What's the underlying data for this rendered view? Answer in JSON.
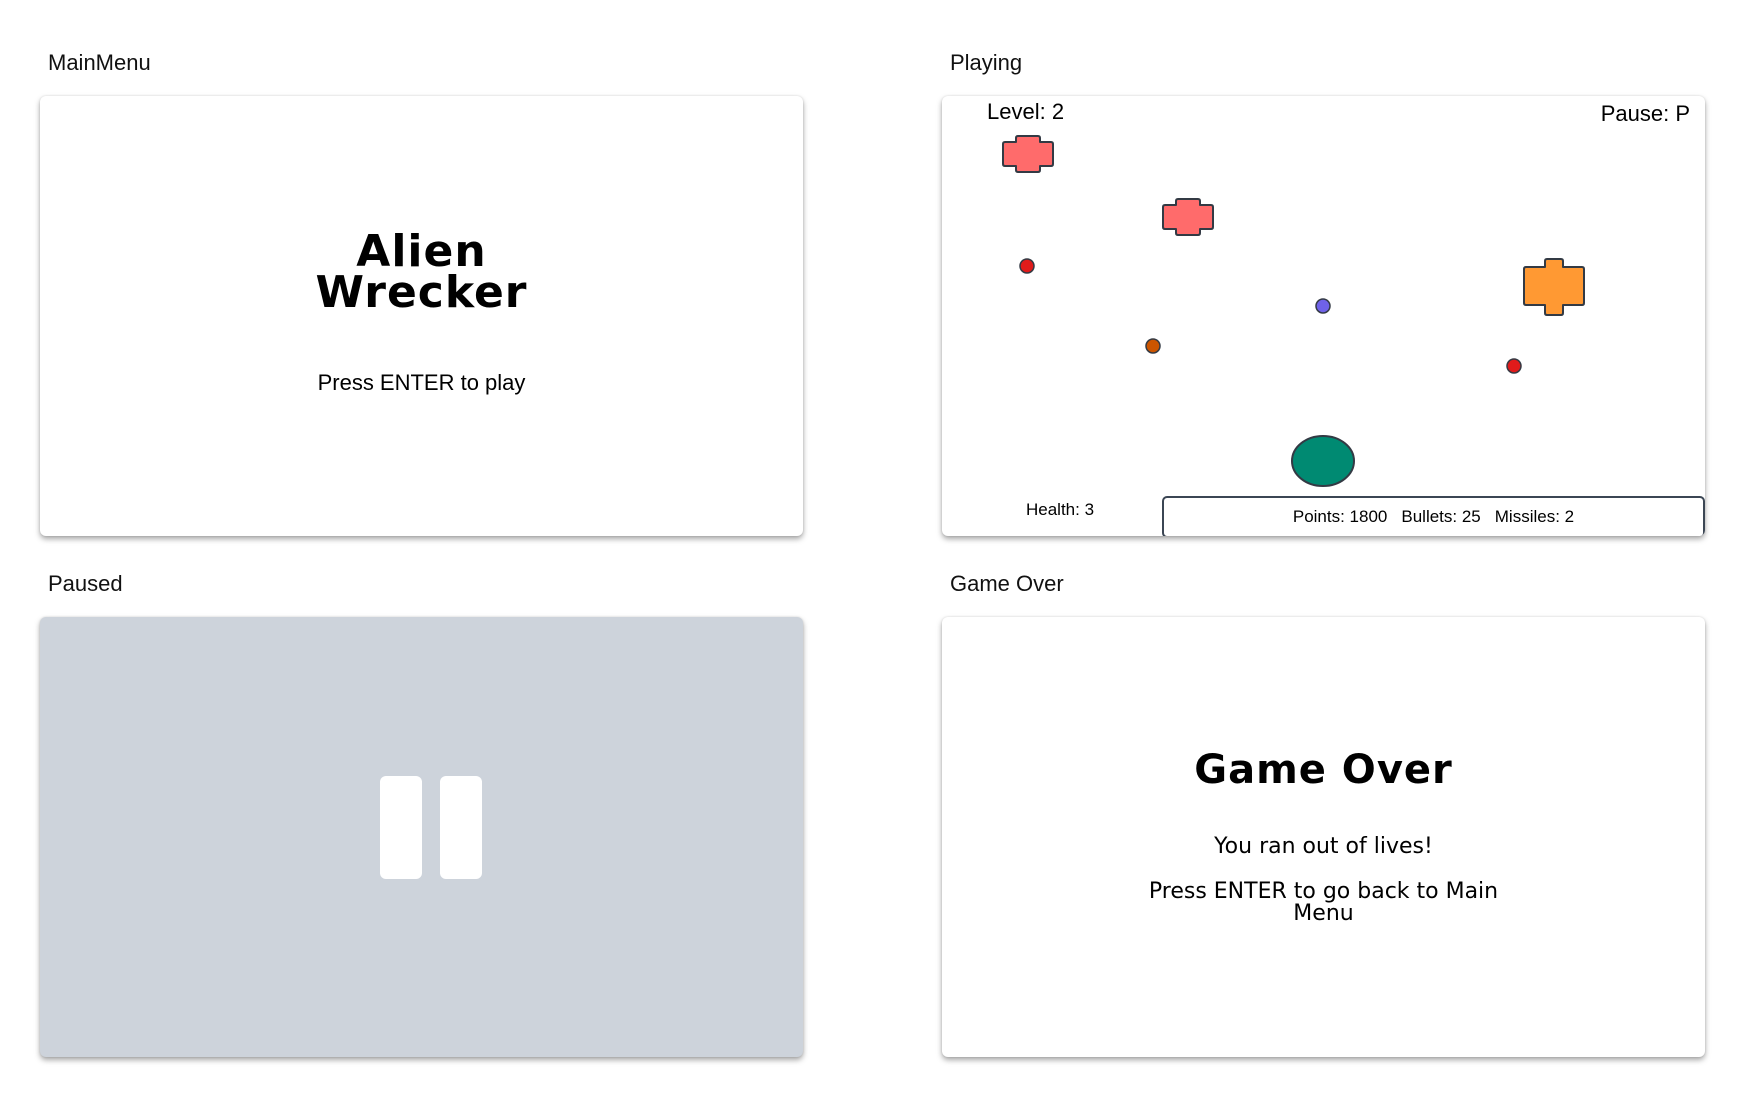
{
  "panels": {
    "main_menu": {
      "label": "MainMenu",
      "title_line1": "Alien",
      "title_line2": "Wrecker",
      "prompt": "Press ENTER to play"
    },
    "playing": {
      "label": "Playing",
      "level_text": "Level: 2",
      "pause_hint": "Pause: P",
      "health_text": "Health: 3",
      "points_text": "Points: 1800",
      "bullets_text": "Bullets: 25",
      "missiles_text": "Missiles: 2",
      "colors": {
        "alien_small": "#ff6b6b",
        "alien_big": "#ff9933",
        "player": "#008a72",
        "bullet_red": "#e01b1b",
        "bullet_orange": "#cc5500",
        "bullet_blue": "#6f62e8",
        "outline": "#333a44"
      }
    },
    "paused": {
      "label": "Paused",
      "background": "#cdd3db",
      "icon": "pause-icon"
    },
    "game_over": {
      "label": "Game Over",
      "title": "Game Over",
      "message": "You ran out of lives!",
      "prompt": "Press ENTER to go back to Main Menu"
    }
  }
}
